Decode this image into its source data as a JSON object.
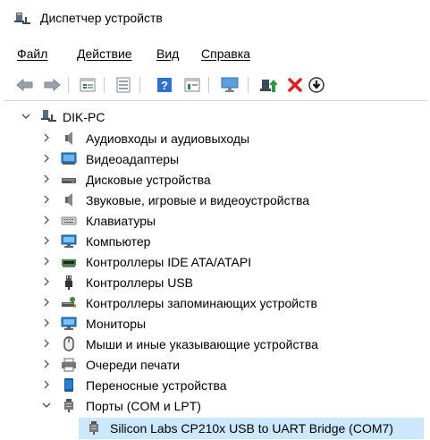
{
  "window": {
    "title": "Диспетчер устройств"
  },
  "menu": [
    {
      "label": "Файл"
    },
    {
      "label": "Действие"
    },
    {
      "label": "Вид"
    },
    {
      "label": "Справка"
    }
  ],
  "toolbar": {
    "buttons": [
      {
        "icon": "back-arrow-icon"
      },
      {
        "icon": "forward-arrow-icon"
      },
      {
        "icon": "properties-icon"
      },
      {
        "icon": "show-hidden-icon"
      },
      {
        "icon": "help-icon"
      },
      {
        "icon": "view-icon"
      },
      {
        "icon": "scan-hardware-icon"
      },
      {
        "icon": "update-driver-icon"
      },
      {
        "icon": "uninstall-icon"
      },
      {
        "icon": "disable-icon"
      }
    ]
  },
  "tree": {
    "root": {
      "label": "DIK-PC",
      "expanded": true
    },
    "categories": [
      {
        "label": "Аудиовходы и аудиовыходы",
        "icon": "speaker-icon"
      },
      {
        "label": "Видеоадаптеры",
        "icon": "display-adapter-icon"
      },
      {
        "label": "Дисковые устройства",
        "icon": "disk-drive-icon"
      },
      {
        "label": "Звуковые, игровые и видеоустройства",
        "icon": "speaker-icon"
      },
      {
        "label": "Клавиатуры",
        "icon": "keyboard-icon"
      },
      {
        "label": "Компьютер",
        "icon": "computer-icon"
      },
      {
        "label": "Контроллеры IDE ATA/ATAPI",
        "icon": "ide-controller-icon"
      },
      {
        "label": "Контроллеры USB",
        "icon": "usb-icon"
      },
      {
        "label": "Контроллеры запоминающих устройств",
        "icon": "storage-controller-icon"
      },
      {
        "label": "Мониторы",
        "icon": "monitor-icon"
      },
      {
        "label": "Мыши и иные указывающие устройства",
        "icon": "mouse-icon"
      },
      {
        "label": "Очереди печати",
        "icon": "printer-icon"
      },
      {
        "label": "Переносные устройства",
        "icon": "portable-device-icon"
      },
      {
        "label": "Порты (COM и LPT)",
        "icon": "port-icon",
        "expanded": true
      }
    ],
    "child": {
      "label": "Silicon Labs CP210x USB to UART Bridge (COM7)",
      "icon": "port-icon"
    }
  }
}
